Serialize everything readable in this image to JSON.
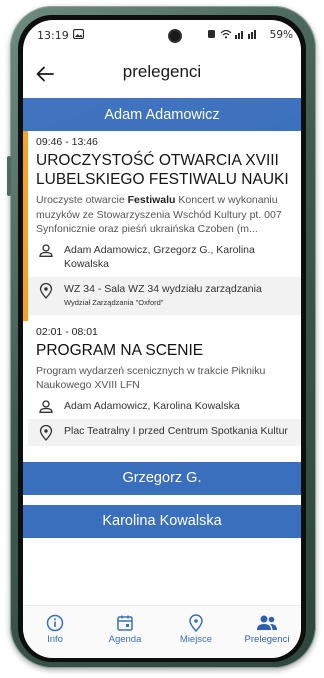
{
  "status_bar": {
    "time": "13:19",
    "battery": "59%"
  },
  "header": {
    "title": "prelegenci"
  },
  "speakers": [
    {
      "name": "Adam Adamowicz",
      "events": [
        {
          "time": "09:46 - 13:46",
          "title": "UROCZYSTOŚĆ OTWARCIA XVIII LUBELSKIEGO FESTIWALU NAUKI",
          "desc_before": "Uroczyste otwarcie ",
          "desc_bold": "Festiwalu",
          "desc_after": " Koncert w wykonaniu muzyków ze Stowarzyszenia Wschód Kultury pt. 007 Synfonicznie oraz pieśń ukraińska Czoben (m...",
          "speakers": "Adam Adamowicz, Grzegorz G., Karolina Kowalska",
          "location": "WZ 34 - Sala WZ 34 wydziału zarządzania",
          "location_sub": "Wydział Zarządzania \"Oxford\""
        },
        {
          "time": "02:01 - 08:01",
          "title": "PROGRAM NA SCENIE",
          "desc": "Program wydarzeń scenicznych w trakcie Pikniku Naukowego XVIII LFN",
          "speakers": "Adam Adamowicz, Karolina Kowalska",
          "location": "Plac Teatralny I przed Centrum Spotkania Kultur"
        }
      ]
    },
    {
      "name": "Grzegorz G."
    },
    {
      "name": "Karolina Kowalska"
    }
  ],
  "bottom_nav": [
    {
      "label": "Info",
      "icon": "info-icon"
    },
    {
      "label": "Agenda",
      "icon": "calendar-icon"
    },
    {
      "label": "Miejsce",
      "icon": "location-icon"
    },
    {
      "label": "Prelegenci",
      "icon": "people-icon",
      "active": true
    }
  ],
  "colors": {
    "accent": "#3a6fbd",
    "highlight": "#f4a21f"
  }
}
